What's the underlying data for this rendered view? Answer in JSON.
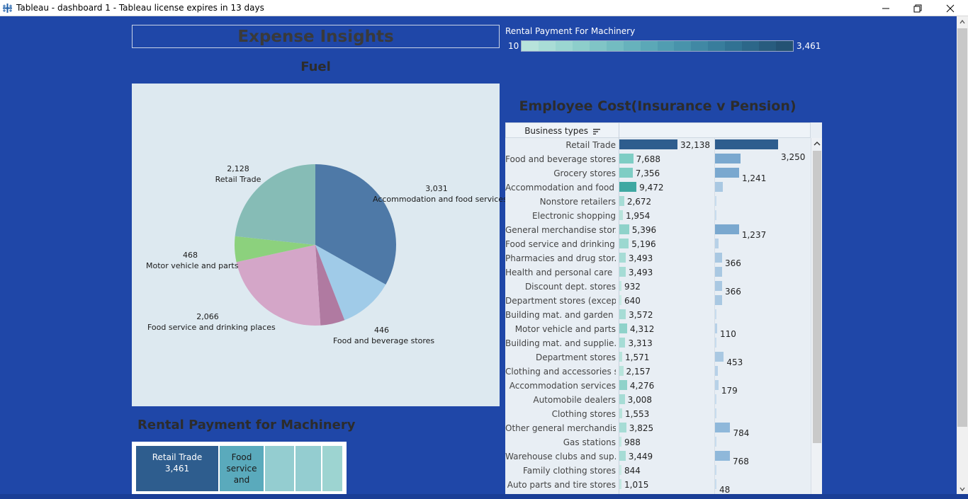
{
  "window": {
    "title": "Tableau - dashboard 1 - Tableau license expires in 13 days",
    "minimize_icon": "minimize-icon",
    "restore_icon": "restore-icon",
    "close_icon": "close-icon"
  },
  "dashboard": {
    "title": "Expense Insights"
  },
  "color_legend": {
    "title": "Rental Payment For Machinery",
    "min": "10",
    "max": "3,461",
    "colors": [
      "#b7e3db",
      "#a9ddd6",
      "#9bd6d1",
      "#8dcecb",
      "#80c5c6",
      "#73bcc1",
      "#67b2bc",
      "#5ba8b7",
      "#519db1",
      "#4893ab",
      "#4088a4",
      "#387d9c",
      "#317293",
      "#2c6789",
      "#285c7e",
      "#245273"
    ]
  },
  "fuel": {
    "title": "Fuel",
    "chart_data": {
      "type": "pie",
      "slices": [
        {
          "label": "Accommodation and food services",
          "value": 3031,
          "display": "3,031",
          "color": "#4e79a7"
        },
        {
          "label": "Food and beverage stores",
          "value": 1000,
          "display": "",
          "color": "#a0cbe8"
        },
        {
          "label": "Food and beverage stores",
          "value": 446,
          "display": "446",
          "color": "#b07aa1"
        },
        {
          "label": "Food service and drinking places",
          "value": 2066,
          "display": "2,066",
          "color": "#d4a6c8"
        },
        {
          "label": "Motor vehicle and parts",
          "value": 468,
          "display": "468",
          "color": "#8cd17d"
        },
        {
          "label": "Retail Trade",
          "value": 2128,
          "display": "2,128",
          "color": "#86bcb6"
        }
      ],
      "labels": [
        {
          "value": "2,128",
          "name": "Retail Trade"
        },
        {
          "value": "3,031",
          "name": "Accommodation and food services"
        },
        {
          "value": "468",
          "name": "Motor vehicle and parts"
        },
        {
          "value": "2,066",
          "name": "Food service and drinking places"
        },
        {
          "value": "446",
          "name": "Food and beverage stores"
        }
      ]
    }
  },
  "employee_cost": {
    "title": "Employee Cost(Insurance v Pension)",
    "column_header": "Business types",
    "chart_data": {
      "type": "bar",
      "categories": [
        "Retail Trade",
        "Food and beverage stores",
        "Grocery stores",
        "Accommodation and food ..",
        "Nonstore retailers",
        "Electronic shopping",
        "General merchandise stor..",
        "Food service and drinking ..",
        "Pharmacies and drug stor..",
        "Health and personal care ..",
        "Discount dept. stores",
        "Department stores (excep..",
        "Building mat. and garden ..",
        "Motor vehicle and parts",
        "Building mat. and supplie..",
        "Department stores",
        "Clothing and accessories s..",
        "Accommodation services",
        "Automobile dealers",
        "Clothing stores",
        "Other general merchandis..",
        "Gas stations",
        "Warehouse clubs and sup..",
        "Family clothing stores",
        "Auto parts and tire stores"
      ],
      "series": [
        {
          "values": [
            32138,
            7688,
            7356,
            9472,
            2672,
            1954,
            5396,
            5196,
            3493,
            3493,
            932,
            640,
            3572,
            4312,
            3313,
            1571,
            2157,
            4276,
            3008,
            1553,
            3825,
            988,
            3449,
            844,
            1015
          ],
          "labels": [
            "32,138",
            "7,688",
            "7,356",
            "9,472",
            "2,672",
            "1,954",
            "5,396",
            "5,196",
            "3,493",
            "3,493",
            "932",
            "640",
            "3,572",
            "4,312",
            "3,313",
            "1,571",
            "2,157",
            "4,276",
            "3,008",
            "1,553",
            "3,825",
            "988",
            "3,449",
            "844",
            "1,015"
          ],
          "colors": [
            "#2e5d8e",
            "#7ecdc4",
            "#7ecdc4",
            "#3fa8a2",
            "#a6dcd5",
            "#b7e3db",
            "#8fd2ca",
            "#9cd8d0",
            "#a6dcd5",
            "#a6dcd5",
            "#c2e8e1",
            "#c8eae4",
            "#a6dcd5",
            "#8fd2ca",
            "#a6dcd5",
            "#b7e3db",
            "#b7e3db",
            "#8fd2ca",
            "#a6dcd5",
            "#b7e3db",
            "#a6dcd5",
            "#c2e8e1",
            "#a6dcd5",
            "#c8eae4",
            "#c2e8e1"
          ]
        },
        {
          "values": [
            3250,
            1300,
            1241,
            400,
            60,
            60,
            1237,
            190,
            366,
            366,
            366,
            366,
            60,
            110,
            60,
            453,
            140,
            179,
            60,
            60,
            784,
            50,
            768,
            50,
            48
          ],
          "labels": [
            "3,250",
            "",
            "1,241",
            "",
            "",
            "",
            "1,237",
            "",
            "366",
            "",
            "366",
            "",
            "",
            "110",
            "",
            "453",
            "",
            "179",
            "",
            "",
            "784",
            "",
            "768",
            "",
            "48"
          ],
          "colors": [
            "#2e5d8e",
            "#7aa8cf",
            "#7aa8cf",
            "#a9c8e2",
            "#c8dcee",
            "#c8dcee",
            "#7aa8cf",
            "#b7d1e8",
            "#a9c8e2",
            "#a9c8e2",
            "#a9c8e2",
            "#a9c8e2",
            "#c8dcee",
            "#b7d1e8",
            "#c8dcee",
            "#a9c8e2",
            "#b7d1e8",
            "#b7d1e8",
            "#c8dcee",
            "#c8dcee",
            "#8fb8da",
            "#c8dcee",
            "#8fb8da",
            "#c8dcee",
            "#c8dcee"
          ]
        }
      ]
    }
  },
  "rental_payment": {
    "title": "Rental Payment for Machinery",
    "chart_data": {
      "type": "treemap",
      "cells": [
        {
          "name": "Retail Trade",
          "value": 3461,
          "display": "3,461",
          "color": "#2e5d8e"
        },
        {
          "name": "Food service and",
          "value": 1000,
          "display": "",
          "color": "#5aaabc"
        },
        {
          "name": "",
          "value": 600,
          "display": "",
          "color": "#94cdd0"
        },
        {
          "name": "",
          "value": 500,
          "display": "",
          "color": "#94cdd0"
        },
        {
          "name": "",
          "value": 400,
          "display": "",
          "color": "#9dd4d1"
        }
      ]
    }
  }
}
